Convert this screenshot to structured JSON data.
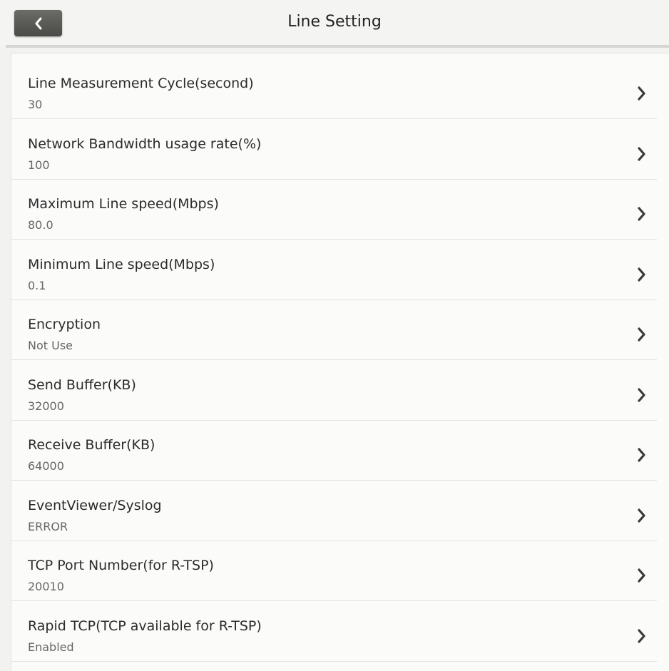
{
  "header": {
    "title": "Line Setting",
    "back_icon": "chevron-left-icon"
  },
  "settings": [
    {
      "label": "Line Measurement Cycle(second)",
      "value": "30"
    },
    {
      "label": "Network Bandwidth usage rate(%)",
      "value": "100"
    },
    {
      "label": "Maximum Line speed(Mbps)",
      "value": "80.0"
    },
    {
      "label": "Minimum Line speed(Mbps)",
      "value": "0.1"
    },
    {
      "label": "Encryption",
      "value": "Not Use"
    },
    {
      "label": "Send Buffer(KB)",
      "value": "32000"
    },
    {
      "label": "Receive Buffer(KB)",
      "value": "64000"
    },
    {
      "label": "EventViewer/Syslog",
      "value": "ERROR"
    },
    {
      "label": "TCP Port Number(for R-TSP)",
      "value": "20010"
    },
    {
      "label": "Rapid TCP(TCP available for R-TSP)",
      "value": "Enabled"
    }
  ],
  "row_icon": "chevron-right-icon",
  "colors": {
    "back_button": "#555552",
    "background": "#f2f2f0",
    "panel": "#fbfbfa",
    "divider": "#e3e3e1"
  }
}
